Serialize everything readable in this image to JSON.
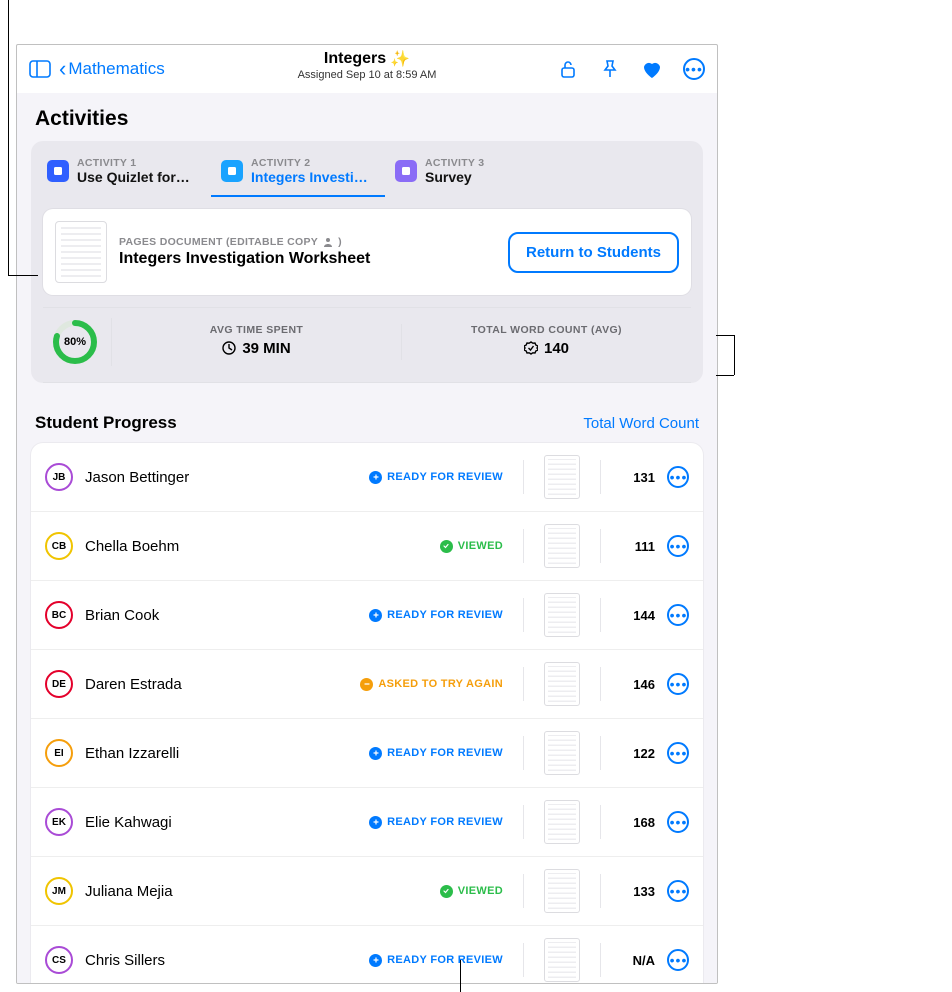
{
  "header": {
    "back_label": "Mathematics",
    "title": "Integers",
    "subtitle": "Assigned Sep 10 at 8:59 AM"
  },
  "section_title": "Activities",
  "tabs": [
    {
      "eyebrow": "ACTIVITY 1",
      "label": "Use Quizlet for…",
      "icon": "quizlet",
      "color": "#2f5fff"
    },
    {
      "eyebrow": "ACTIVITY 2",
      "label": "Integers Investi…",
      "icon": "pages",
      "color": "#1aa3ff"
    },
    {
      "eyebrow": "ACTIVITY 3",
      "label": "Survey",
      "icon": "survey",
      "color": "#8a6cf6"
    }
  ],
  "document": {
    "eyebrow": "PAGES DOCUMENT (EDITABLE COPY",
    "eyebrow_suffix": ")",
    "title": "Integers Investigation Worksheet",
    "button": "Return to Students"
  },
  "stats": {
    "percent": "80%",
    "percent_num": 80,
    "time_label": "AVG TIME SPENT",
    "time_value": "39 MIN",
    "words_label": "TOTAL WORD COUNT (AVG)",
    "words_value": "140"
  },
  "progress": {
    "heading": "Student Progress",
    "link": "Total Word Count"
  },
  "status_labels": {
    "ready": "READY FOR REVIEW",
    "viewed": "VIEWED",
    "retry": "ASKED TO TRY AGAIN"
  },
  "students": [
    {
      "initials": "JB",
      "name": "Jason Bettinger",
      "ring": "#a94bd6",
      "status": "ready",
      "count": "131"
    },
    {
      "initials": "CB",
      "name": "Chella Boehm",
      "ring": "#f0c400",
      "status": "viewed",
      "count": "111"
    },
    {
      "initials": "BC",
      "name": "Brian Cook",
      "ring": "#e4002b",
      "status": "ready",
      "count": "144"
    },
    {
      "initials": "DE",
      "name": "Daren Estrada",
      "ring": "#e4002b",
      "status": "retry",
      "count": "146"
    },
    {
      "initials": "EI",
      "name": "Ethan Izzarelli",
      "ring": "#f59e0b",
      "status": "ready",
      "count": "122"
    },
    {
      "initials": "EK",
      "name": "Elie Kahwagi",
      "ring": "#a94bd6",
      "status": "ready",
      "count": "168"
    },
    {
      "initials": "JM",
      "name": "Juliana Mejia",
      "ring": "#f0c400",
      "status": "viewed",
      "count": "133"
    },
    {
      "initials": "CS",
      "name": "Chris Sillers",
      "ring": "#a94bd6",
      "status": "ready",
      "count": "N/A"
    }
  ]
}
